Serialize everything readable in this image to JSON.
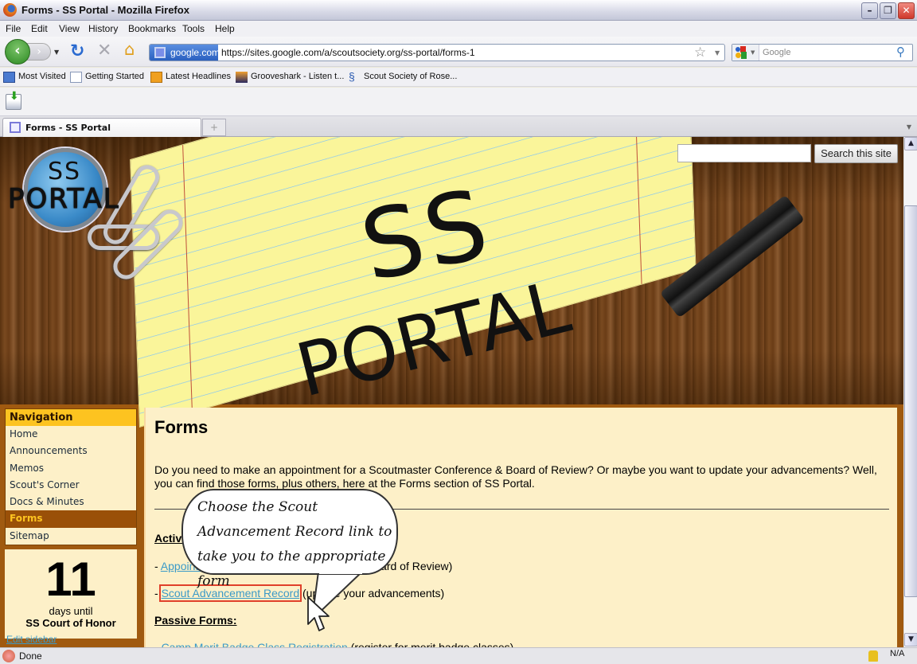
{
  "window": {
    "title": "Forms - SS Portal - Mozilla Firefox"
  },
  "menu": [
    "File",
    "Edit",
    "View",
    "History",
    "Bookmarks",
    "Tools",
    "Help"
  ],
  "navbar": {
    "site_identity": "google.com",
    "url": "https://sites.google.com/a/scoutsociety.org/ss-portal/forms-1",
    "search_placeholder": "Google"
  },
  "bookmarks": [
    "Most Visited",
    "Getting Started",
    "Latest Headlines",
    "Grooveshark - Listen t...",
    "Scout Society of Rose..."
  ],
  "tabs": [
    {
      "label": "Forms - SS Portal",
      "active": true
    }
  ],
  "site": {
    "logo_top": "SS",
    "logo_bottom": "PORTAL",
    "banner_line1": "SS",
    "banner_line2": "PORTAL",
    "search_button": "Search this site",
    "search_value": ""
  },
  "sidebar": {
    "heading": "Navigation",
    "items": [
      {
        "label": "Home"
      },
      {
        "label": "Announcements"
      },
      {
        "label": "Memos"
      },
      {
        "label": "Scout's Corner"
      },
      {
        "label": "Docs & Minutes"
      },
      {
        "label": "Forms",
        "active": true
      },
      {
        "label": "Sitemap"
      }
    ],
    "countdown": {
      "number": "11",
      "until": "days until",
      "event": "SS Court of Honor"
    },
    "edit_link": "Edit sidebar"
  },
  "main": {
    "title": "Forms",
    "intro": "Do you need to make an appointment for a Scoutmaster Conference & Board of Review? Or maybe you want to update your advancements? Well, you can find those forms, plus others, here at the Forms section of SS Portal.",
    "active_heading": "Active Forms:",
    "active_forms": [
      {
        "prefix": "- ",
        "link": "Appointment",
        "desc": " (Scoutmaster Conference & Board of Review)"
      },
      {
        "prefix": "- ",
        "link": "Scout Advancement Record",
        "desc": " (update your advancements)"
      }
    ],
    "passive_heading": "Passive Forms:",
    "passive_forms": [
      {
        "prefix": "- ",
        "link": "Camp Merit Badge Class Registration",
        "desc": " (register for merit badge classes)"
      }
    ]
  },
  "callout": {
    "text": "Choose the Scout Advancement Record link to take you to the appropriate form"
  },
  "status": {
    "text": "Done",
    "security": "N/A"
  },
  "colors": {
    "nav_heading_bg": "#fdc320",
    "nav_active_bg": "#9a5008",
    "content_bg": "#fdf0c8",
    "link": "#3a9ac8",
    "highlight": "#e0402a"
  }
}
